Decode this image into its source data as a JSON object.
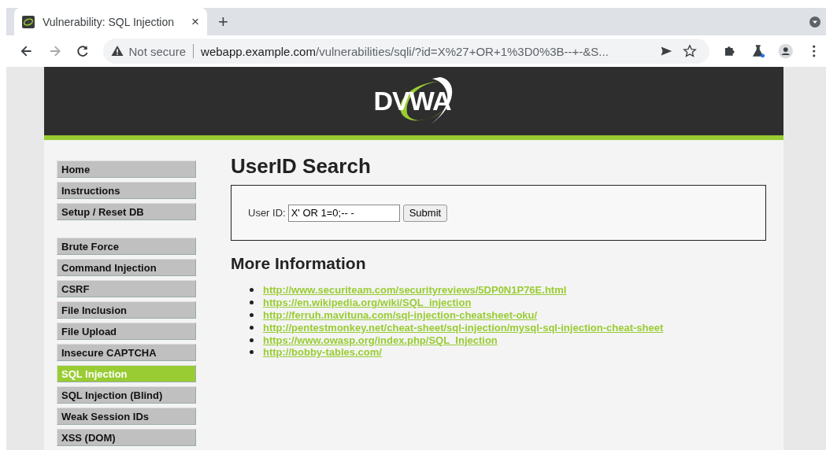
{
  "browser": {
    "tab": {
      "title": "Vulnerability: SQL Injection",
      "close": "×"
    },
    "new_tab": "+",
    "security": "Not secure",
    "url_host": "webapp.example.com",
    "url_path": "/vulnerabilities/sqli/?id=X%27+OR+1%3D0%3B--+-&S..."
  },
  "header": {
    "logo": "DVWA"
  },
  "menu": [
    [
      {
        "label": "Home",
        "selected": false
      },
      {
        "label": "Instructions",
        "selected": false
      },
      {
        "label": "Setup / Reset DB",
        "selected": false
      }
    ],
    [
      {
        "label": "Brute Force",
        "selected": false
      },
      {
        "label": "Command Injection",
        "selected": false
      },
      {
        "label": "CSRF",
        "selected": false
      },
      {
        "label": "File Inclusion",
        "selected": false
      },
      {
        "label": "File Upload",
        "selected": false
      },
      {
        "label": "Insecure CAPTCHA",
        "selected": false
      },
      {
        "label": "SQL Injection",
        "selected": true
      },
      {
        "label": "SQL Injection (Blind)",
        "selected": false
      },
      {
        "label": "Weak Session IDs",
        "selected": false
      },
      {
        "label": "XSS (DOM)",
        "selected": false
      }
    ]
  ],
  "main": {
    "title": "UserID Search",
    "form": {
      "label": "User ID:",
      "value": "X' OR 1=0;-- -",
      "button": "Submit"
    },
    "more_title": "More Information",
    "links": [
      "http://www.securiteam.com/securityreviews/5DP0N1P76E.html",
      "https://en.wikipedia.org/wiki/SQL_injection",
      "http://ferruh.mavituna.com/sql-injection-cheatsheet-oku/",
      "http://pentestmonkey.net/cheat-sheet/sql-injection/mysql-sql-injection-cheat-sheet",
      "https://www.owasp.org/index.php/SQL_Injection",
      "http://bobby-tables.com/"
    ]
  }
}
